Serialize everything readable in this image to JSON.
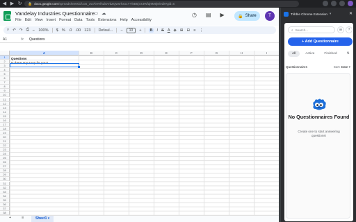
{
  "browser": {
    "url_host": "docs.google.com",
    "url_path": "/spreadsheets/d/1os_3U7bYelhLlDVbZQwsrhxo1TYlsB5j723Wfaj9M0j8/edit#gid=0"
  },
  "sheets": {
    "title": "Vandelay Industries Questionnaire",
    "menu": [
      "File",
      "Edit",
      "View",
      "Insert",
      "Format",
      "Data",
      "Tools",
      "Extensions",
      "Help",
      "Accessibility"
    ],
    "share_label": "Share",
    "avatar_initial": "T",
    "toolbar": {
      "zoom": "100%",
      "font": "Defaul...",
      "font_size": "10",
      "bold": "B",
      "currency": "$",
      "percent": "%",
      "decimal_less": ".0",
      "decimal_more": ".00",
      "number_fmt": "123"
    },
    "cell_ref": "A1",
    "formula_value": "Questions",
    "columns": [
      "A",
      "B",
      "C",
      "D",
      "E",
      "F",
      "G",
      "H",
      "I"
    ],
    "rows": [
      "1",
      "2",
      "3",
      "4",
      "5",
      "6",
      "7",
      "8",
      "9",
      "10",
      "11",
      "12",
      "13",
      "14",
      "15",
      "16",
      "17",
      "18",
      "19",
      "20",
      "21",
      "22",
      "23",
      "24",
      "25",
      "26",
      "27",
      "28",
      "29",
      "30",
      "31",
      "32",
      "33",
      "34",
      "35",
      "36",
      "37",
      "38"
    ],
    "cells": {
      "a1": "Questions",
      "a2": "Is there any soup for you?"
    },
    "sheet_tab": "Sheet1"
  },
  "extension": {
    "header": "Tribble Chrome Extension",
    "search_placeholder": "Search...",
    "add_button": "+ Add Questionnaire",
    "filters": [
      "All",
      "Active",
      "Finished"
    ],
    "list_label": "Questionnaires",
    "sort_label": "Sort:",
    "sort_value": "Date",
    "empty_title": "No Questionnaires Found",
    "empty_text": "Create one to start answering questions!"
  }
}
